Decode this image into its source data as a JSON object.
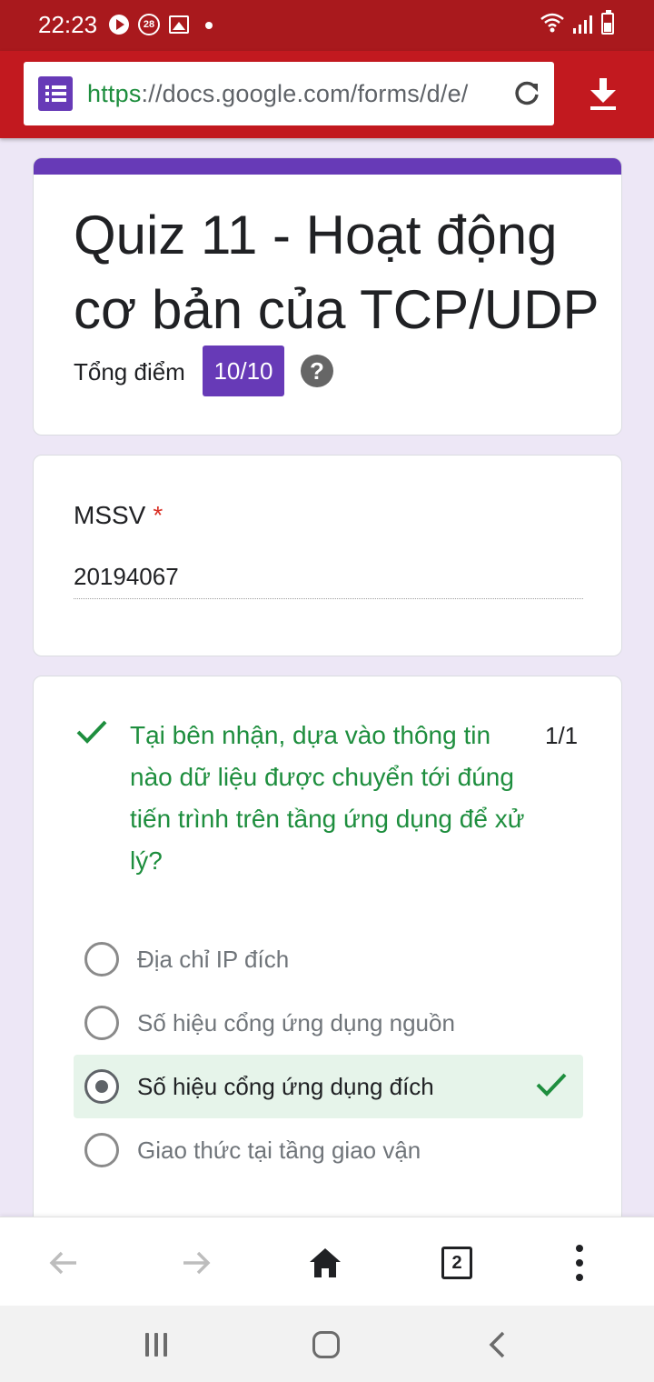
{
  "status_bar": {
    "time": "22:23",
    "notification_badge": "28",
    "icons": [
      "play-icon",
      "notification-count-icon",
      "image-icon",
      "dot-icon",
      "wifi-icon",
      "signal-icon",
      "battery-icon"
    ]
  },
  "browser": {
    "url_scheme": "https",
    "url_rest": "://docs.google.com/forms/d/e/",
    "site_icon": "google-forms-icon",
    "reload_icon": "reload-icon",
    "download_icon": "download-icon",
    "tab_count": "2"
  },
  "form": {
    "accent_color": "#673ab7",
    "title": "Quiz 11 - Hoạt động cơ bản của TCP/UDP",
    "score_label": "Tổng điểm",
    "score_value": "10/10",
    "help_symbol": "?"
  },
  "mssv": {
    "label": "MSSV",
    "required_mark": "*",
    "value": "20194067"
  },
  "question": {
    "text": "Tại bên nhận, dựa vào thông tin nào dữ liệu được chuyển tới đúng tiến trình trên tầng ứng dụng để xử lý?",
    "points": "1/1",
    "correct_color": "#1e8e3e",
    "options": [
      {
        "label": "Địa chỉ IP đích",
        "selected": false
      },
      {
        "label": "Số hiệu cổng ứng dụng nguồn",
        "selected": false
      },
      {
        "label": "Số hiệu cổng ứng dụng đích",
        "selected": true,
        "correct": true
      },
      {
        "label": "Giao thức tại tầng giao vận",
        "selected": false
      }
    ]
  },
  "bottom_bar": {
    "icons": [
      "back-arrow-icon",
      "forward-arrow-icon",
      "home-icon",
      "tab-switcher-icon",
      "more-menu-icon"
    ]
  },
  "nav_bar": {
    "icons": [
      "recents-icon",
      "home-nav-icon",
      "back-nav-icon"
    ]
  }
}
